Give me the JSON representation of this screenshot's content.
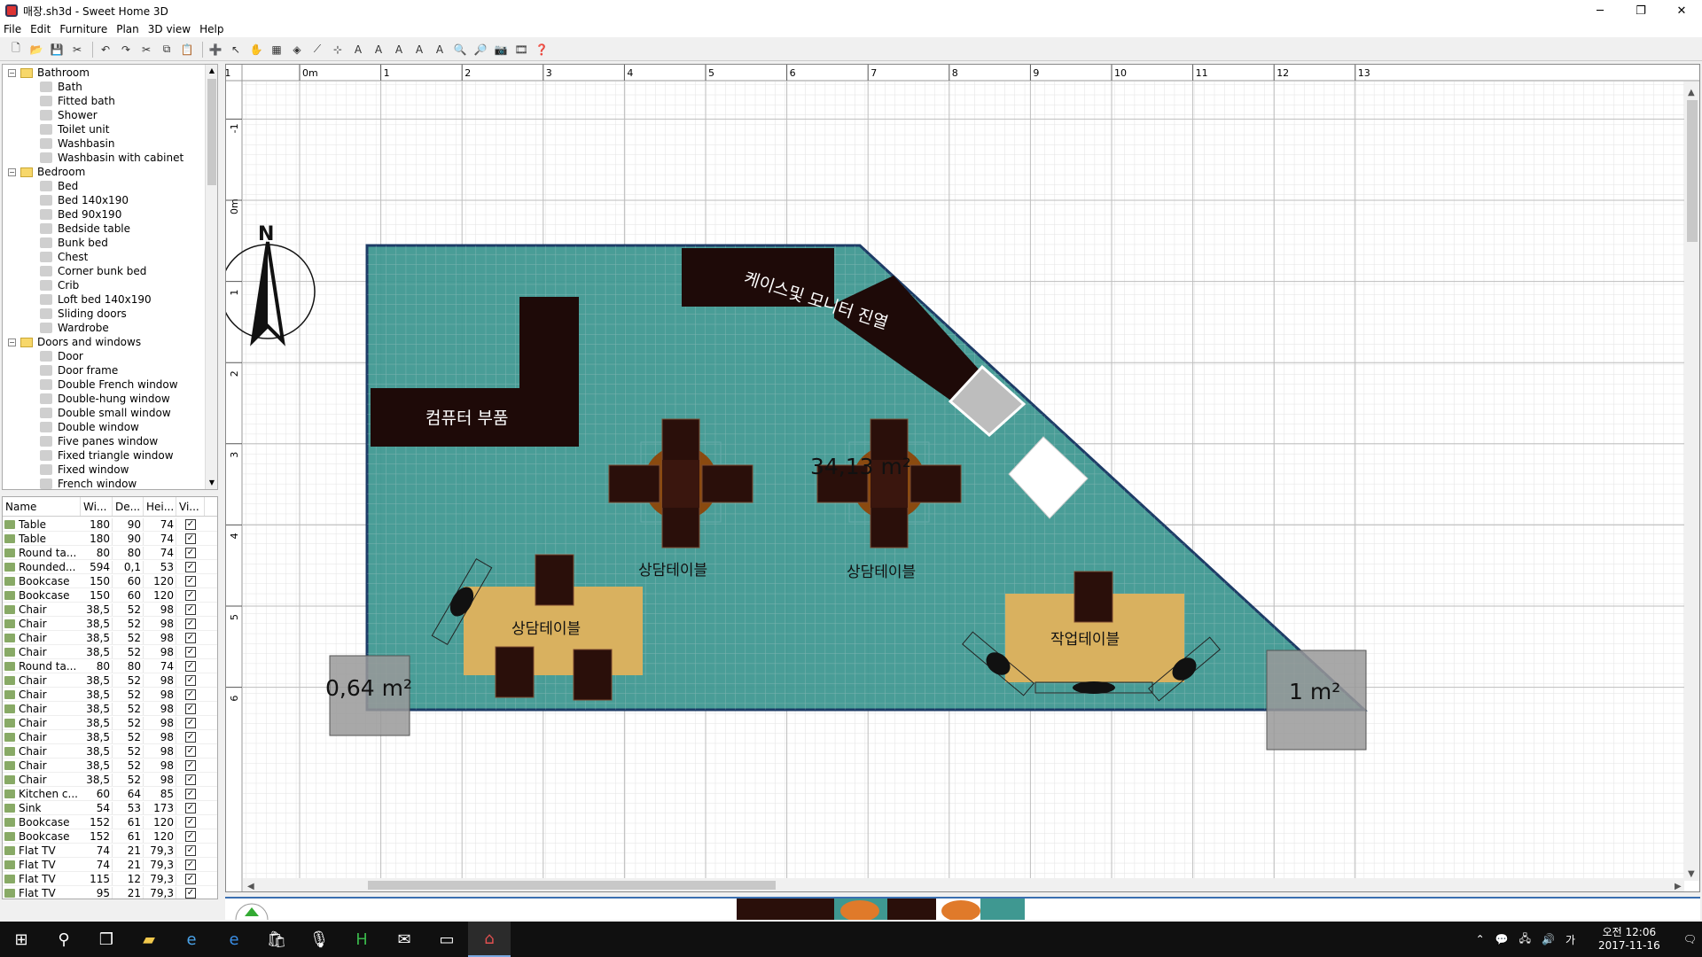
{
  "window": {
    "title": "매장.sh3d - Sweet Home 3D",
    "minimize": "─",
    "maximize": "❐",
    "close": "✕"
  },
  "menu": [
    "File",
    "Edit",
    "Furniture",
    "Plan",
    "3D view",
    "Help"
  ],
  "catalog": [
    {
      "type": "cat",
      "label": "Bathroom"
    },
    {
      "type": "leaf",
      "label": "Bath"
    },
    {
      "type": "leaf",
      "label": "Fitted bath"
    },
    {
      "type": "leaf",
      "label": "Shower"
    },
    {
      "type": "leaf",
      "label": "Toilet unit"
    },
    {
      "type": "leaf",
      "label": "Washbasin"
    },
    {
      "type": "leaf",
      "label": "Washbasin with cabinet"
    },
    {
      "type": "cat",
      "label": "Bedroom"
    },
    {
      "type": "leaf",
      "label": "Bed"
    },
    {
      "type": "leaf",
      "label": "Bed 140x190"
    },
    {
      "type": "leaf",
      "label": "Bed 90x190"
    },
    {
      "type": "leaf",
      "label": "Bedside table"
    },
    {
      "type": "leaf",
      "label": "Bunk bed"
    },
    {
      "type": "leaf",
      "label": "Chest"
    },
    {
      "type": "leaf",
      "label": "Corner bunk bed"
    },
    {
      "type": "leaf",
      "label": "Crib"
    },
    {
      "type": "leaf",
      "label": "Loft bed 140x190"
    },
    {
      "type": "leaf",
      "label": "Sliding doors"
    },
    {
      "type": "leaf",
      "label": "Wardrobe"
    },
    {
      "type": "cat",
      "label": "Doors and windows"
    },
    {
      "type": "leaf",
      "label": "Door"
    },
    {
      "type": "leaf",
      "label": "Door frame"
    },
    {
      "type": "leaf",
      "label": "Double French window"
    },
    {
      "type": "leaf",
      "label": "Double-hung window"
    },
    {
      "type": "leaf",
      "label": "Double small window"
    },
    {
      "type": "leaf",
      "label": "Double window"
    },
    {
      "type": "leaf",
      "label": "Five panes window"
    },
    {
      "type": "leaf",
      "label": "Fixed triangle window"
    },
    {
      "type": "leaf",
      "label": "Fixed window"
    },
    {
      "type": "leaf",
      "label": "French window"
    }
  ],
  "furniture_table": {
    "headers": [
      "Name",
      "Wi...",
      "De...",
      "Hei...",
      "Vi..."
    ],
    "rows": [
      [
        "Table",
        "180",
        "90",
        "74"
      ],
      [
        "Table",
        "180",
        "90",
        "74"
      ],
      [
        "Round ta...",
        "80",
        "80",
        "74"
      ],
      [
        "Rounded...",
        "594",
        "0,1",
        "53"
      ],
      [
        "Bookcase",
        "150",
        "60",
        "120"
      ],
      [
        "Bookcase",
        "150",
        "60",
        "120"
      ],
      [
        "Chair",
        "38,5",
        "52",
        "98"
      ],
      [
        "Chair",
        "38,5",
        "52",
        "98"
      ],
      [
        "Chair",
        "38,5",
        "52",
        "98"
      ],
      [
        "Chair",
        "38,5",
        "52",
        "98"
      ],
      [
        "Round ta...",
        "80",
        "80",
        "74"
      ],
      [
        "Chair",
        "38,5",
        "52",
        "98"
      ],
      [
        "Chair",
        "38,5",
        "52",
        "98"
      ],
      [
        "Chair",
        "38,5",
        "52",
        "98"
      ],
      [
        "Chair",
        "38,5",
        "52",
        "98"
      ],
      [
        "Chair",
        "38,5",
        "52",
        "98"
      ],
      [
        "Chair",
        "38,5",
        "52",
        "98"
      ],
      [
        "Chair",
        "38,5",
        "52",
        "98"
      ],
      [
        "Chair",
        "38,5",
        "52",
        "98"
      ],
      [
        "Kitchen c...",
        "60",
        "64",
        "85"
      ],
      [
        "Sink",
        "54",
        "53",
        "173"
      ],
      [
        "Bookcase",
        "152",
        "61",
        "120"
      ],
      [
        "Bookcase",
        "152",
        "61",
        "120"
      ],
      [
        "Flat TV",
        "74",
        "21",
        "79,3"
      ],
      [
        "Flat TV",
        "74",
        "21",
        "79,3"
      ],
      [
        "Flat TV",
        "115",
        "12",
        "79,3"
      ],
      [
        "Flat TV",
        "95",
        "21",
        "79,3"
      ]
    ],
    "visible_mark": "✓"
  },
  "plan": {
    "ruler_top": [
      "-1",
      "0m",
      "1",
      "2",
      "3",
      "4",
      "5",
      "6",
      "7",
      "8",
      "9",
      "10",
      "11",
      "12",
      "13"
    ],
    "ruler_left": [
      "-1",
      "0m",
      "1",
      "2",
      "3",
      "4",
      "5",
      "6"
    ],
    "compass_label": "N",
    "room_area": "34,13 m²",
    "area_left": "0,64 m²",
    "area_right": "1 m²",
    "labels": {
      "computer_parts": "컴퓨터 부품",
      "case_monitor": "케이스및 모니터 진열",
      "consult_1": "상담테이블",
      "consult_2": "상담테이블",
      "consult_3": "상담테이블",
      "work_table": "작업테이블"
    },
    "colors": {
      "room": "#3f9891",
      "dark_furniture": "#1e0a08",
      "table_tan": "#d9b15f",
      "round_table": "#8a4a10",
      "grid": "#d8d8d8"
    }
  },
  "taskbar": {
    "clock_time": "오전 12:06",
    "clock_date": "2017-11-16",
    "ime": "가"
  }
}
